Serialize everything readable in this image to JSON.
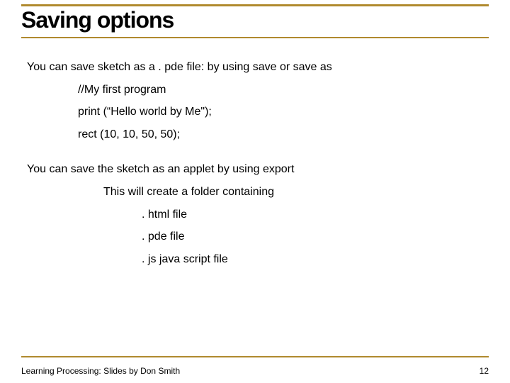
{
  "slide": {
    "title": "Saving options",
    "body": {
      "line1": "You can save sketch as a . pde file: by using save or save as",
      "code1": "//My first program",
      "code2": "print (“Hello world by Me\");",
      "code3": "rect (10, 10, 50, 50);",
      "line2": "You can save the sketch as an applet by using export",
      "sub1": "This will create a folder containing",
      "f1": ". html file",
      "f2": ". pde file",
      "f3": ". js java script file"
    },
    "footer_text": "Learning Processing:  Slides by Don Smith",
    "page_number": "12"
  }
}
